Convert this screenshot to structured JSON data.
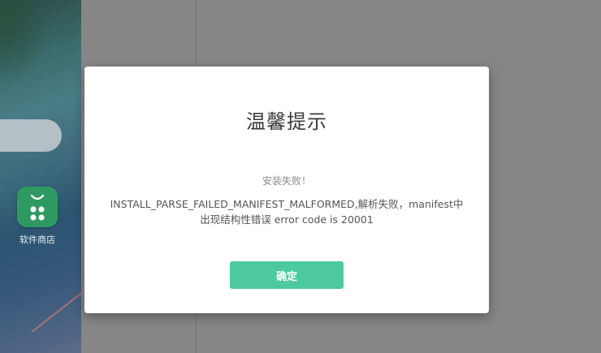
{
  "launcher": {
    "app_label": "软件商店",
    "app_icon": "shopping-bag-icon"
  },
  "dialog": {
    "title": "温馨提示",
    "subtitle": "安装失败！",
    "message_line1": "INSTALL_PARSE_FAILED_MANIFEST_MALFORMED,解析失败，manifest中",
    "message_line2": "出现结构性错误 error code is 20001",
    "confirm_label": "确定"
  },
  "colors": {
    "overlay": "#868686",
    "accent": "#4cc9a0",
    "app_icon_bg": "#2e9a62"
  }
}
